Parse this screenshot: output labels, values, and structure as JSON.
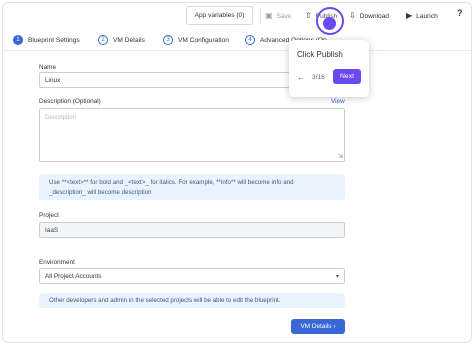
{
  "toolbar": {
    "app_variables_label": "App variables (0)",
    "save_label": "Save",
    "publish_label": "Publish",
    "download_label": "Download",
    "launch_label": "Launch",
    "help_label": "?"
  },
  "steps": [
    {
      "number": "1",
      "label": "Blueprint Settings"
    },
    {
      "number": "2",
      "label": "VM Details"
    },
    {
      "number": "3",
      "label": "VM Configuration"
    },
    {
      "number": "4",
      "label": "Advanced Options (Op"
    }
  ],
  "form": {
    "name_label": "Name",
    "name_value": "Linux",
    "description_label": "Description (Optional)",
    "view_label": "View",
    "description_placeholder": "Description",
    "hint_formatting_line1": "Use **<text>** for bold and _<text>_ for italics. For example, **info** will become info and",
    "hint_formatting_line2": "_description_ will become description",
    "project_label": "Project",
    "project_value": "IaaS",
    "environment_label": "Environment",
    "environment_value": "All Project Accounts",
    "hint_environment": "Other developers and admin in the selected projects will be able to edit the blueprint.",
    "next_button_label": "VM Details"
  },
  "walkthrough": {
    "title": "Click Publish",
    "counter": "3/16",
    "next_label": "Next"
  },
  "colors": {
    "primary": "#3a67d8",
    "walkthrough_accent": "#6b48f0",
    "hint_background": "#e9f3fd"
  }
}
